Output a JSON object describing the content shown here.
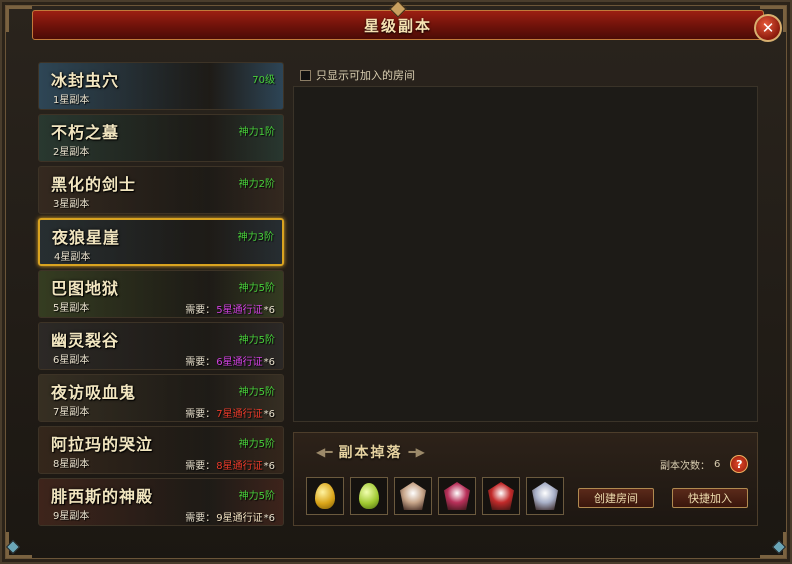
{
  "window": {
    "title": "星级副本",
    "close": "✕"
  },
  "filter": {
    "label": "只显示可加入的房间"
  },
  "dungeons": [
    {
      "name": "冰封虫穴",
      "stars": "1星副本",
      "power": "70级",
      "req_prefix": "",
      "req_pass": "",
      "req_count": "",
      "bg": "#2f5a7a",
      "pass_color": ""
    },
    {
      "name": "不朽之墓",
      "stars": "2星副本",
      "power": "神力1阶",
      "req_prefix": "",
      "req_pass": "",
      "req_count": "",
      "bg": "#27433a",
      "pass_color": ""
    },
    {
      "name": "黑化的剑士",
      "stars": "3星副本",
      "power": "神力2阶",
      "req_prefix": "",
      "req_pass": "",
      "req_count": "",
      "bg": "#3a2a1f",
      "pass_color": ""
    },
    {
      "name": "夜狼星崖",
      "stars": "4星副本",
      "power": "神力3阶",
      "req_prefix": "",
      "req_pass": "",
      "req_count": "",
      "bg": "#24333d",
      "pass_color": ""
    },
    {
      "name": "巴图地狱",
      "stars": "5星副本",
      "power": "神力5阶",
      "req_prefix": "需要：",
      "req_pass": "5星通行证",
      "req_count": "*6",
      "bg": "#3b4a22",
      "pass_color": "#d040e0"
    },
    {
      "name": "幽灵裂谷",
      "stars": "6星副本",
      "power": "神力5阶",
      "req_prefix": "需要：",
      "req_pass": "6星通行证",
      "req_count": "*6",
      "bg": "#2c2a2a",
      "pass_color": "#d040e0"
    },
    {
      "name": "夜访吸血鬼",
      "stars": "7星副本",
      "power": "神力5阶",
      "req_prefix": "需要：",
      "req_pass": "7星通行证",
      "req_count": "*6",
      "bg": "#3d3424",
      "pass_color": "#e83a2a"
    },
    {
      "name": "阿拉玛的哭泣",
      "stars": "8星副本",
      "power": "神力5阶",
      "req_prefix": "需要：",
      "req_pass": "8星通行证",
      "req_count": "*6",
      "bg": "#3a2618",
      "pass_color": "#e83a2a"
    },
    {
      "name": "腓西斯的神殿",
      "stars": "9星副本",
      "power": "神力5阶",
      "req_prefix": "需要：",
      "req_pass": "9星通行证",
      "req_count": "*6",
      "bg": "#4a2218",
      "pass_color": "#f0e0c0"
    }
  ],
  "selected_index": 3,
  "drops": {
    "title": "副本掉落",
    "count_label": "副本次数：",
    "count_value": "6",
    "help": "?",
    "items": [
      {
        "icon": "gold-egg-icon",
        "kind": "egg gold"
      },
      {
        "icon": "green-egg-icon",
        "kind": "egg green"
      },
      {
        "icon": "armor-icon",
        "color": "#c8a68a"
      },
      {
        "icon": "crimson-helm-icon",
        "color": "#b8305a"
      },
      {
        "icon": "ruby-armor-icon",
        "color": "#c22a2a"
      },
      {
        "icon": "winged-emblem-icon",
        "color": "#a8b0c8"
      }
    ]
  },
  "buttons": {
    "create": "创建房间",
    "quick_join": "快捷加入"
  }
}
